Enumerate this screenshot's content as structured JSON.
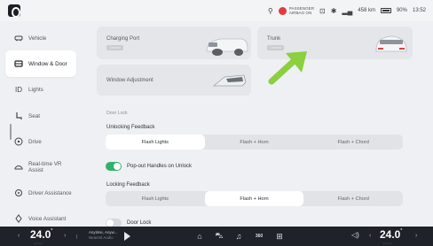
{
  "status": {
    "airbag_line1": "PASSENGER",
    "airbag_line2": "AIRBAG ON",
    "range": "458 km",
    "battery": "90%",
    "time": "13:52"
  },
  "sidebar": {
    "items": [
      {
        "label": "Vehicle",
        "icon": "car-icon"
      },
      {
        "label": "Window & Door",
        "icon": "window-door-icon"
      },
      {
        "label": "Lights",
        "icon": "lights-icon"
      },
      {
        "label": "Seat",
        "icon": "seat-icon"
      },
      {
        "label": "Drive",
        "icon": "steering-wheel-icon"
      },
      {
        "label": "Real-time VR Assist",
        "icon": "vr-assist-icon"
      },
      {
        "label": "Driver Assistance",
        "icon": "driver-assistance-icon"
      },
      {
        "label": "Voice Assistant",
        "icon": "voice-assistant-icon"
      }
    ]
  },
  "main": {
    "charging_port": {
      "title": "Charging Port",
      "badge": "Closed"
    },
    "trunk": {
      "title": "Trunk",
      "badge": "Closed"
    },
    "window_adjustment": {
      "title": "Window Adjustment"
    },
    "door_lock_section": "Door Lock",
    "unlocking_feedback": {
      "label": "Unlocking Feedback",
      "options": [
        "Flash Lights",
        "Flash + Horn",
        "Flash + Chord"
      ],
      "selected": "Flash Lights"
    },
    "popout_handles": {
      "label": "Pop-out Handles on Unlock",
      "on": true
    },
    "locking_feedback": {
      "label": "Locking Feedback",
      "options": [
        "Flash Lights",
        "Flash + Horn",
        "Flash + Chord"
      ],
      "selected": "Flash + Horn"
    },
    "door_lock_toggle": {
      "label": "Door Lock",
      "on": false
    }
  },
  "bottom": {
    "left_temp": "24.0",
    "right_temp": "24.0",
    "temp_unit": "°",
    "media_title": "Anytime, Anyw...",
    "media_sub": "Nearest Audio",
    "dock_360_label": "360",
    "accent_color": "#2fb36c"
  }
}
